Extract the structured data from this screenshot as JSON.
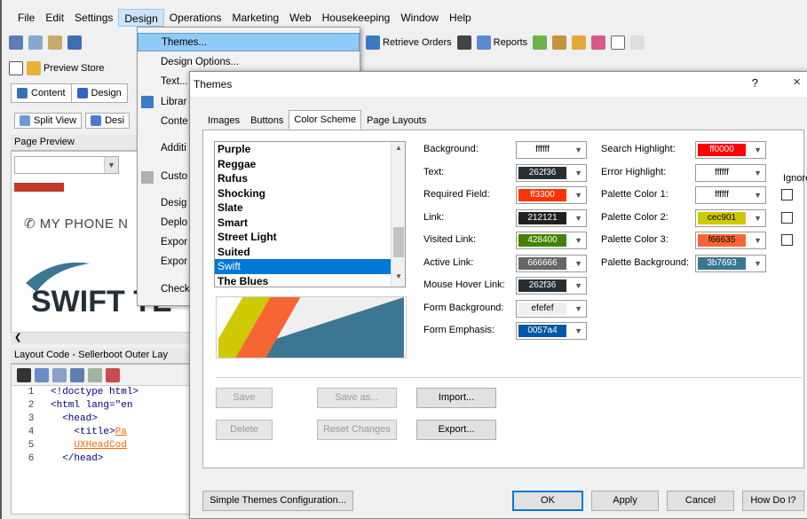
{
  "menubar": [
    "File",
    "Edit",
    "Settings",
    "Design",
    "Operations",
    "Marketing",
    "Web",
    "Housekeeping",
    "Window",
    "Help"
  ],
  "toolbar": {
    "retrieve_orders": "Retrieve Orders",
    "reports": "Reports",
    "preview_store": "Preview Store"
  },
  "left": {
    "tab_content": "Content",
    "tab_design": "Design",
    "split_view": "Split View",
    "design_btn": "Desi",
    "page_preview_title": "Page Preview",
    "phone_text": "MY PHONE N",
    "logo_text": "SWIFT TE",
    "layout_code_title": "Layout Code - Sellerboot Outer Lay",
    "code_lines": [
      {
        "n": "1",
        "t": "<!doctype html>"
      },
      {
        "n": "2",
        "t": "<html lang=\"en"
      },
      {
        "n": "3",
        "t": "  <head>"
      },
      {
        "n": "4",
        "t": "    <title>",
        "h": "Pa"
      },
      {
        "n": "5",
        "t": "    ",
        "h": "UXHeadCod"
      },
      {
        "n": "6",
        "t": "  </head>"
      }
    ]
  },
  "design_menu": {
    "items": [
      "Themes...",
      "Design Options...",
      "Text...",
      "Librar",
      "Conte",
      "Additi",
      "Custo",
      "Desig",
      "Deplo",
      "Expor",
      "Expor",
      "Check"
    ]
  },
  "dialog": {
    "title": "Themes",
    "help": "?",
    "close": "×",
    "tabs": [
      "Images",
      "Buttons",
      "Color Scheme",
      "Page Layouts"
    ],
    "active_tab": "Color Scheme",
    "themes": [
      "Purple",
      "Reggae",
      "Rufus",
      "Shocking",
      "Slate",
      "Smart",
      "Street Light",
      "Suited",
      "Swift",
      "The Blues"
    ],
    "selected_theme": "Swift",
    "fields_left": [
      {
        "label": "Background:",
        "value": "ffffff",
        "bg": "#ffffff",
        "fg": "#000000"
      },
      {
        "label": "Text:",
        "value": "262f36",
        "bg": "#262f36",
        "fg": "#ffffff"
      },
      {
        "label": "Required Field:",
        "value": "ff3300",
        "bg": "#ff3300",
        "fg": "#ffffff"
      },
      {
        "label": "Link:",
        "value": "212121",
        "bg": "#212121",
        "fg": "#ffffff"
      },
      {
        "label": "Visited Link:",
        "value": "428400",
        "bg": "#428400",
        "fg": "#ffffff"
      },
      {
        "label": "Active Link:",
        "value": "666666",
        "bg": "#666666",
        "fg": "#ffffff"
      },
      {
        "label": "Mouse Hover Link:",
        "value": "262f36",
        "bg": "#262f36",
        "fg": "#ffffff"
      },
      {
        "label": "Form Background:",
        "value": "efefef",
        "bg": "#efefef",
        "fg": "#000000"
      },
      {
        "label": "Form Emphasis:",
        "value": "0057a4",
        "bg": "#0057a4",
        "fg": "#ffffff"
      }
    ],
    "fields_right": [
      {
        "label": "Search Highlight:",
        "value": "ff0000",
        "bg": "#ff0000",
        "fg": "#ffffff"
      },
      {
        "label": "Error Highlight:",
        "value": "ffffff",
        "bg": "#ffffff",
        "fg": "#000000"
      },
      {
        "label": "Palette Color 1:",
        "value": "ffffff",
        "bg": "#ffffff",
        "fg": "#000000"
      },
      {
        "label": "Palette Color 2:",
        "value": "cec901",
        "bg": "#cec901",
        "fg": "#000000"
      },
      {
        "label": "Palette Color 3:",
        "value": "f66635",
        "bg": "#f66635",
        "fg": "#000000"
      },
      {
        "label": "Palette Background:",
        "value": "3b7693",
        "bg": "#3b7693",
        "fg": "#ffffff"
      }
    ],
    "ignore_label": "Ignore:",
    "buttons": {
      "save": "Save",
      "save_as": "Save as...",
      "import": "Import...",
      "delete": "Delete",
      "reset": "Reset Changes",
      "export": "Export...",
      "simple": "Simple Themes Configuration...",
      "ok": "OK",
      "apply": "Apply",
      "cancel": "Cancel",
      "howdo": "How Do I?"
    }
  }
}
